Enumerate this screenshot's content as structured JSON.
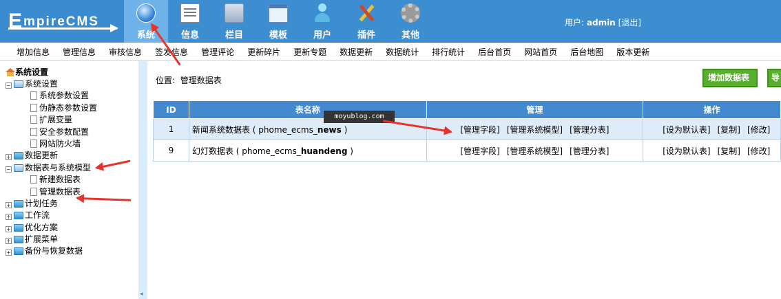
{
  "header": {
    "logo_text": "mpireCMS",
    "logo_big_letter": "E",
    "nav": [
      {
        "label": "系统",
        "icon": "globe-icon"
      },
      {
        "label": "信息",
        "icon": "document-icon"
      },
      {
        "label": "栏目",
        "icon": "folder-icon"
      },
      {
        "label": "模板",
        "icon": "window-icon"
      },
      {
        "label": "用户",
        "icon": "user-icon"
      },
      {
        "label": "插件",
        "icon": "tools-icon"
      },
      {
        "label": "其他",
        "icon": "gear-icon"
      }
    ],
    "user_prefix": "用户:",
    "username": "admin",
    "logout": "[退出]"
  },
  "submenu": [
    "增加信息",
    "管理信息",
    "审核信息",
    "签发信息",
    "管理评论",
    "更新碎片",
    "更新专题",
    "数据更新",
    "数据统计",
    "排行统计",
    "后台首页",
    "网站首页",
    "后台地图",
    "版本更新"
  ],
  "tree": {
    "root": "系统设置",
    "items": [
      {
        "label": "系统设置",
        "toggle": "−",
        "children": [
          "系统参数设置",
          "伪静态参数设置",
          "扩展变量",
          "安全参数配置",
          "网站防火墙"
        ]
      },
      {
        "label": "数据更新",
        "toggle": "+",
        "children": []
      },
      {
        "label": "数据表与系统模型",
        "toggle": "−",
        "children": [
          "新建数据表",
          "管理数据表"
        ]
      },
      {
        "label": "计划任务",
        "toggle": "+",
        "children": []
      },
      {
        "label": "工作流",
        "toggle": "+",
        "children": []
      },
      {
        "label": "优化方案",
        "toggle": "+",
        "children": []
      },
      {
        "label": "扩展菜单",
        "toggle": "+",
        "children": []
      },
      {
        "label": "备份与恢复数据",
        "toggle": "+",
        "children": []
      }
    ]
  },
  "main": {
    "location_prefix": "位置:",
    "location": "管理数据表",
    "add_button": "增加数据表",
    "import_button": "导",
    "watermark": "moyublog.com",
    "columns": [
      "ID",
      "表名称",
      "管理",
      "操作"
    ],
    "rows": [
      {
        "id": "1",
        "name": "新闻系统数据表 (",
        "code_prefix": "phome_ecms_",
        "code_bold": "news",
        "close": ")",
        "manage": [
          "[管理字段]",
          "[管理系统模型]",
          "[管理分表]"
        ],
        "ops": [
          "[设为默认表]",
          "[复制]",
          "[修改]"
        ]
      },
      {
        "id": "9",
        "name": "幻灯数据表 (",
        "code_prefix": "phome_ecms_",
        "code_bold": "huandeng",
        "close": ")",
        "manage": [
          "[管理字段]",
          "[管理系统模型]",
          "[管理分表]"
        ],
        "ops": [
          "[设为默认表]",
          "[复制]",
          "[修改]"
        ]
      }
    ]
  },
  "colors": {
    "header": "#3d8ed1",
    "table_header": "#4289cf",
    "button": "#5aae2e",
    "arrow": "#e8322c"
  }
}
